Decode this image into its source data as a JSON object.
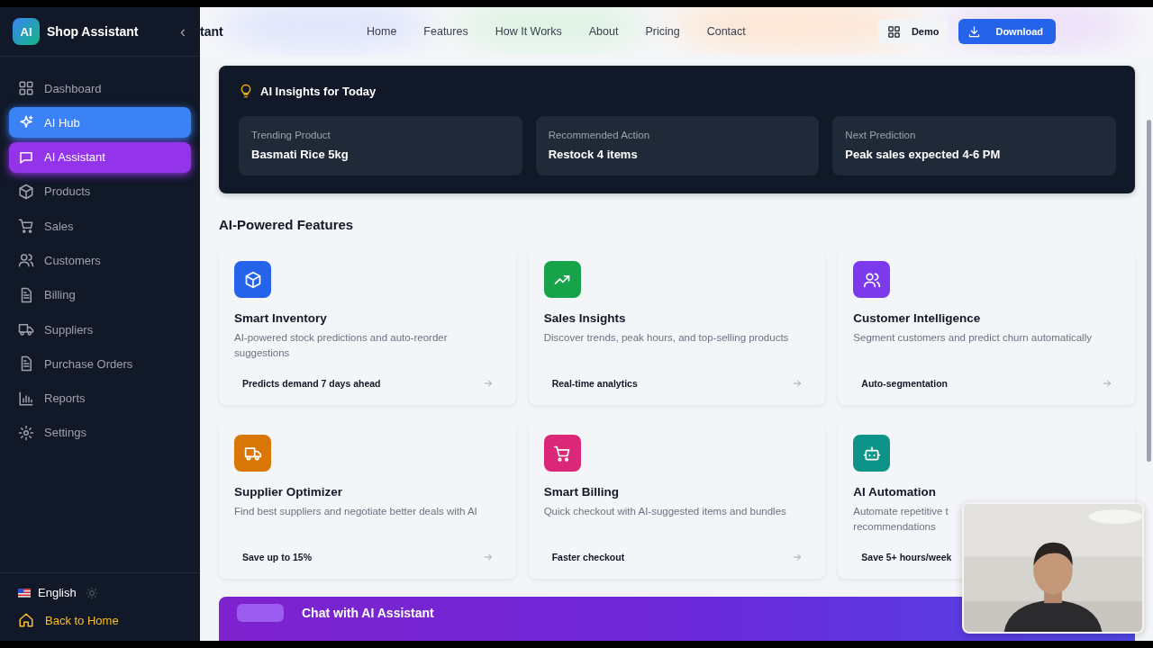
{
  "sidebar": {
    "logo": "AI",
    "title": "Shop Assistant",
    "collapse": "‹",
    "items": [
      {
        "label": "Dashboard",
        "selected": false
      },
      {
        "label": "AI Hub",
        "selected": true,
        "color": "#3b82f6"
      },
      {
        "label": "AI Assistant",
        "selected": true,
        "color": "#9333ea"
      },
      {
        "label": "Products",
        "selected": false
      },
      {
        "label": "Sales",
        "selected": false
      },
      {
        "label": "Customers",
        "selected": false
      },
      {
        "label": "Billing",
        "selected": false
      },
      {
        "label": "Suppliers",
        "selected": false
      },
      {
        "label": "Purchase Orders",
        "selected": false
      },
      {
        "label": "Reports",
        "selected": false
      },
      {
        "label": "Settings",
        "selected": false
      }
    ],
    "language": "English",
    "back": "Back to Home"
  },
  "topbar": {
    "brand": "tant",
    "nav": [
      "Home",
      "Features",
      "How It Works",
      "About",
      "Pricing",
      "Contact"
    ],
    "demo": "Demo",
    "download": "Download"
  },
  "insights": {
    "title": "AI Insights for Today",
    "items": [
      {
        "label": "Trending Product",
        "value": "Basmati Rice 5kg"
      },
      {
        "label": "Recommended Action",
        "value": "Restock 4 items"
      },
      {
        "label": "Next Prediction",
        "value": "Peak sales expected 4-6 PM"
      }
    ]
  },
  "features": {
    "title": "AI-Powered Features",
    "items": [
      {
        "color": "#2563eb",
        "title": "Smart Inventory",
        "description": "AI-powered stock predictions and auto-reorder suggestions",
        "tag": "Predicts demand 7 days ahead"
      },
      {
        "color": "#16a34a",
        "title": "Sales Insights",
        "description": "Discover trends, peak hours, and top-selling products",
        "tag": "Real-time analytics"
      },
      {
        "color": "#7c3aed",
        "title": "Customer Intelligence",
        "description": "Segment customers and predict churn automatically",
        "tag": "Auto-segmentation"
      },
      {
        "color": "#d97706",
        "title": "Supplier Optimizer",
        "description": "Find best suppliers and negotiate better deals with AI",
        "tag": "Save up to 15%"
      },
      {
        "color": "#db2777",
        "title": "Smart Billing",
        "description": "Quick checkout with AI-suggested items and bundles",
        "tag": "Faster checkout"
      },
      {
        "color": "#0d9488",
        "title": "AI Automation",
        "description": "Automate repetitive t\nrecommendations",
        "tag": "Save 5+ hours/week"
      }
    ]
  },
  "banner": {
    "title": "Chat with AI Assistant"
  }
}
